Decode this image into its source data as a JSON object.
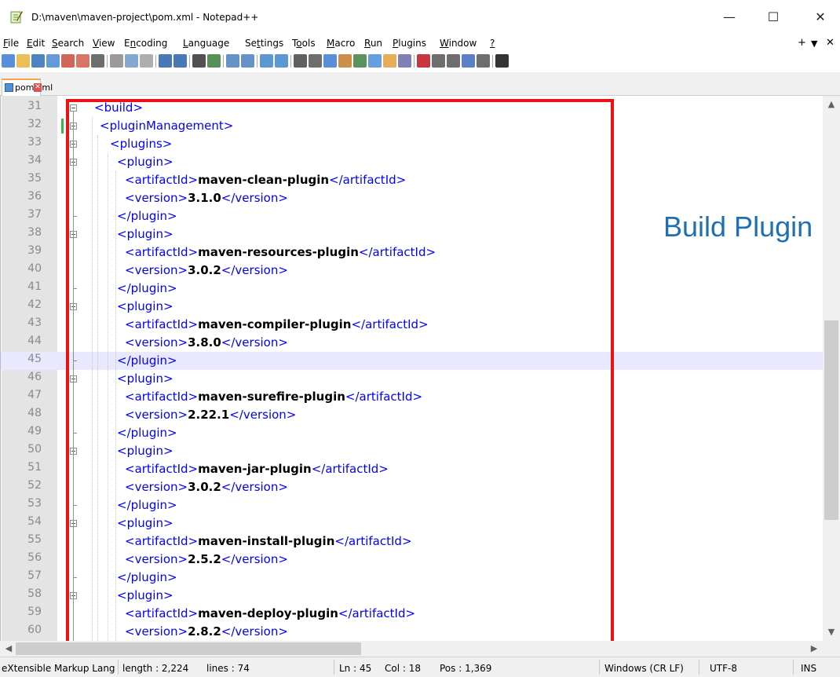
{
  "window": {
    "title": "D:\\maven\\maven-project\\pom.xml - Notepad++",
    "minimize_glyph": "—",
    "maximize_glyph": "☐",
    "close_glyph": "✕"
  },
  "menubar": {
    "items": [
      {
        "u": "F",
        "rest": "ile"
      },
      {
        "u": "E",
        "rest": "dit"
      },
      {
        "u": "S",
        "rest": "earch"
      },
      {
        "u": "V",
        "rest": "iew"
      },
      {
        "pre": "E",
        "u": "n",
        "rest": "coding"
      },
      {
        "u": "L",
        "rest": "anguage"
      },
      {
        "pre": "Se",
        "u": "t",
        "rest": "tings"
      },
      {
        "pre": "T",
        "u": "o",
        "rest": "ols"
      },
      {
        "u": "M",
        "rest": "acro"
      },
      {
        "u": "R",
        "rest": "un"
      },
      {
        "u": "P",
        "rest": "lugins"
      },
      {
        "u": "W",
        "rest": "indow"
      },
      {
        "u": "?",
        "rest": ""
      }
    ],
    "right": {
      "plus": "+",
      "down": "▼",
      "close": "✕"
    }
  },
  "tab": {
    "label": "pom.xml",
    "close_glyph": "✕"
  },
  "editor": {
    "current_line": 45,
    "lines": [
      {
        "n": "31",
        "indent": 0,
        "parts": [
          [
            "t",
            "<build>"
          ]
        ]
      },
      {
        "n": "32",
        "indent": 1,
        "parts": [
          [
            "t",
            "<pluginManagement>"
          ]
        ]
      },
      {
        "n": "33",
        "indent": 2,
        "parts": [
          [
            "t",
            "<plugins>"
          ]
        ]
      },
      {
        "n": "34",
        "indent": 3,
        "parts": [
          [
            "t",
            "<plugin>"
          ]
        ]
      },
      {
        "n": "35",
        "indent": 4,
        "parts": [
          [
            "t",
            "<artifactId>"
          ],
          [
            "v",
            "maven-clean-plugin"
          ],
          [
            "t",
            "</artifactId>"
          ]
        ]
      },
      {
        "n": "36",
        "indent": 4,
        "parts": [
          [
            "t",
            "<version>"
          ],
          [
            "v",
            "3.1.0"
          ],
          [
            "t",
            "</version>"
          ]
        ]
      },
      {
        "n": "37",
        "indent": 3,
        "parts": [
          [
            "t",
            "</plugin>"
          ]
        ]
      },
      {
        "n": "38",
        "indent": 3,
        "parts": [
          [
            "t",
            "<plugin>"
          ]
        ]
      },
      {
        "n": "39",
        "indent": 4,
        "parts": [
          [
            "t",
            "<artifactId>"
          ],
          [
            "v",
            "maven-resources-plugin"
          ],
          [
            "t",
            "</artifactId>"
          ]
        ]
      },
      {
        "n": "40",
        "indent": 4,
        "parts": [
          [
            "t",
            "<version>"
          ],
          [
            "v",
            "3.0.2"
          ],
          [
            "t",
            "</version>"
          ]
        ]
      },
      {
        "n": "41",
        "indent": 3,
        "parts": [
          [
            "t",
            "</plugin>"
          ]
        ]
      },
      {
        "n": "42",
        "indent": 3,
        "parts": [
          [
            "t",
            "<plugin>"
          ]
        ]
      },
      {
        "n": "43",
        "indent": 4,
        "parts": [
          [
            "t",
            "<artifactId>"
          ],
          [
            "v",
            "maven-compiler-plugin"
          ],
          [
            "t",
            "</artifactId>"
          ]
        ]
      },
      {
        "n": "44",
        "indent": 4,
        "parts": [
          [
            "t",
            "<version>"
          ],
          [
            "v",
            "3.8.0"
          ],
          [
            "t",
            "</version>"
          ]
        ]
      },
      {
        "n": "45",
        "indent": 3,
        "parts": [
          [
            "t",
            "</plugin>"
          ]
        ]
      },
      {
        "n": "46",
        "indent": 3,
        "parts": [
          [
            "t",
            "<plugin>"
          ]
        ]
      },
      {
        "n": "47",
        "indent": 4,
        "parts": [
          [
            "t",
            "<artifactId>"
          ],
          [
            "v",
            "maven-surefire-plugin"
          ],
          [
            "t",
            "</artifactId>"
          ]
        ]
      },
      {
        "n": "48",
        "indent": 4,
        "parts": [
          [
            "t",
            "<version>"
          ],
          [
            "v",
            "2.22.1"
          ],
          [
            "t",
            "</version>"
          ]
        ]
      },
      {
        "n": "49",
        "indent": 3,
        "parts": [
          [
            "t",
            "</plugin>"
          ]
        ]
      },
      {
        "n": "50",
        "indent": 3,
        "parts": [
          [
            "t",
            "<plugin>"
          ]
        ]
      },
      {
        "n": "51",
        "indent": 4,
        "parts": [
          [
            "t",
            "<artifactId>"
          ],
          [
            "v",
            "maven-jar-plugin"
          ],
          [
            "t",
            "</artifactId>"
          ]
        ]
      },
      {
        "n": "52",
        "indent": 4,
        "parts": [
          [
            "t",
            "<version>"
          ],
          [
            "v",
            "3.0.2"
          ],
          [
            "t",
            "</version>"
          ]
        ]
      },
      {
        "n": "53",
        "indent": 3,
        "parts": [
          [
            "t",
            "</plugin>"
          ]
        ]
      },
      {
        "n": "54",
        "indent": 3,
        "parts": [
          [
            "t",
            "<plugin>"
          ]
        ]
      },
      {
        "n": "55",
        "indent": 4,
        "parts": [
          [
            "t",
            "<artifactId>"
          ],
          [
            "v",
            "maven-install-plugin"
          ],
          [
            "t",
            "</artifactId>"
          ]
        ]
      },
      {
        "n": "56",
        "indent": 4,
        "parts": [
          [
            "t",
            "<version>"
          ],
          [
            "v",
            "2.5.2"
          ],
          [
            "t",
            "</version>"
          ]
        ]
      },
      {
        "n": "57",
        "indent": 3,
        "parts": [
          [
            "t",
            "</plugin>"
          ]
        ]
      },
      {
        "n": "58",
        "indent": 3,
        "parts": [
          [
            "t",
            "<plugin>"
          ]
        ]
      },
      {
        "n": "59",
        "indent": 4,
        "parts": [
          [
            "t",
            "<artifactId>"
          ],
          [
            "v",
            "maven-deploy-plugin"
          ],
          [
            "t",
            "</artifactId>"
          ]
        ]
      },
      {
        "n": "60",
        "indent": 4,
        "parts": [
          [
            "t",
            "<version>"
          ],
          [
            "v",
            "2.8.2"
          ],
          [
            "t",
            "</version>"
          ]
        ]
      }
    ]
  },
  "annotation": {
    "text": "Build Plugin"
  },
  "status": {
    "language": "eXtensible Markup Lang",
    "length": "length : 2,224",
    "lines": "lines : 74",
    "ln": "Ln : 45",
    "col": "Col : 18",
    "pos": "Pos : 1,369",
    "eol": "Windows (CR LF)",
    "encoding": "UTF-8",
    "mode": "INS"
  },
  "colors": {
    "tag": "#0000ff",
    "highlight_box": "#ee1111",
    "annotation": "#1f6fb3",
    "current_line": "#e8e8ff",
    "change_mark": "#39b54a"
  },
  "toolbar_icons": [
    "new-file-icon",
    "open-file-icon",
    "save-icon",
    "save-all-icon",
    "close-icon",
    "close-all-icon",
    "print-icon",
    "cut-icon",
    "copy-icon",
    "paste-icon",
    "undo-icon",
    "redo-icon",
    "find-icon",
    "replace-icon",
    "zoom-in-icon",
    "zoom-out-icon",
    "sync-vertical-icon",
    "sync-horizontal-icon",
    "word-wrap-icon",
    "show-all-chars-icon",
    "indent-guide-icon",
    "udl-icon",
    "doc-map-icon",
    "function-list-icon",
    "folder-workspace-icon",
    "monitoring-icon",
    "record-macro-icon",
    "stop-macro-icon",
    "play-macro-icon",
    "run-macro-multiple-icon",
    "save-macro-icon",
    "run-icon"
  ]
}
